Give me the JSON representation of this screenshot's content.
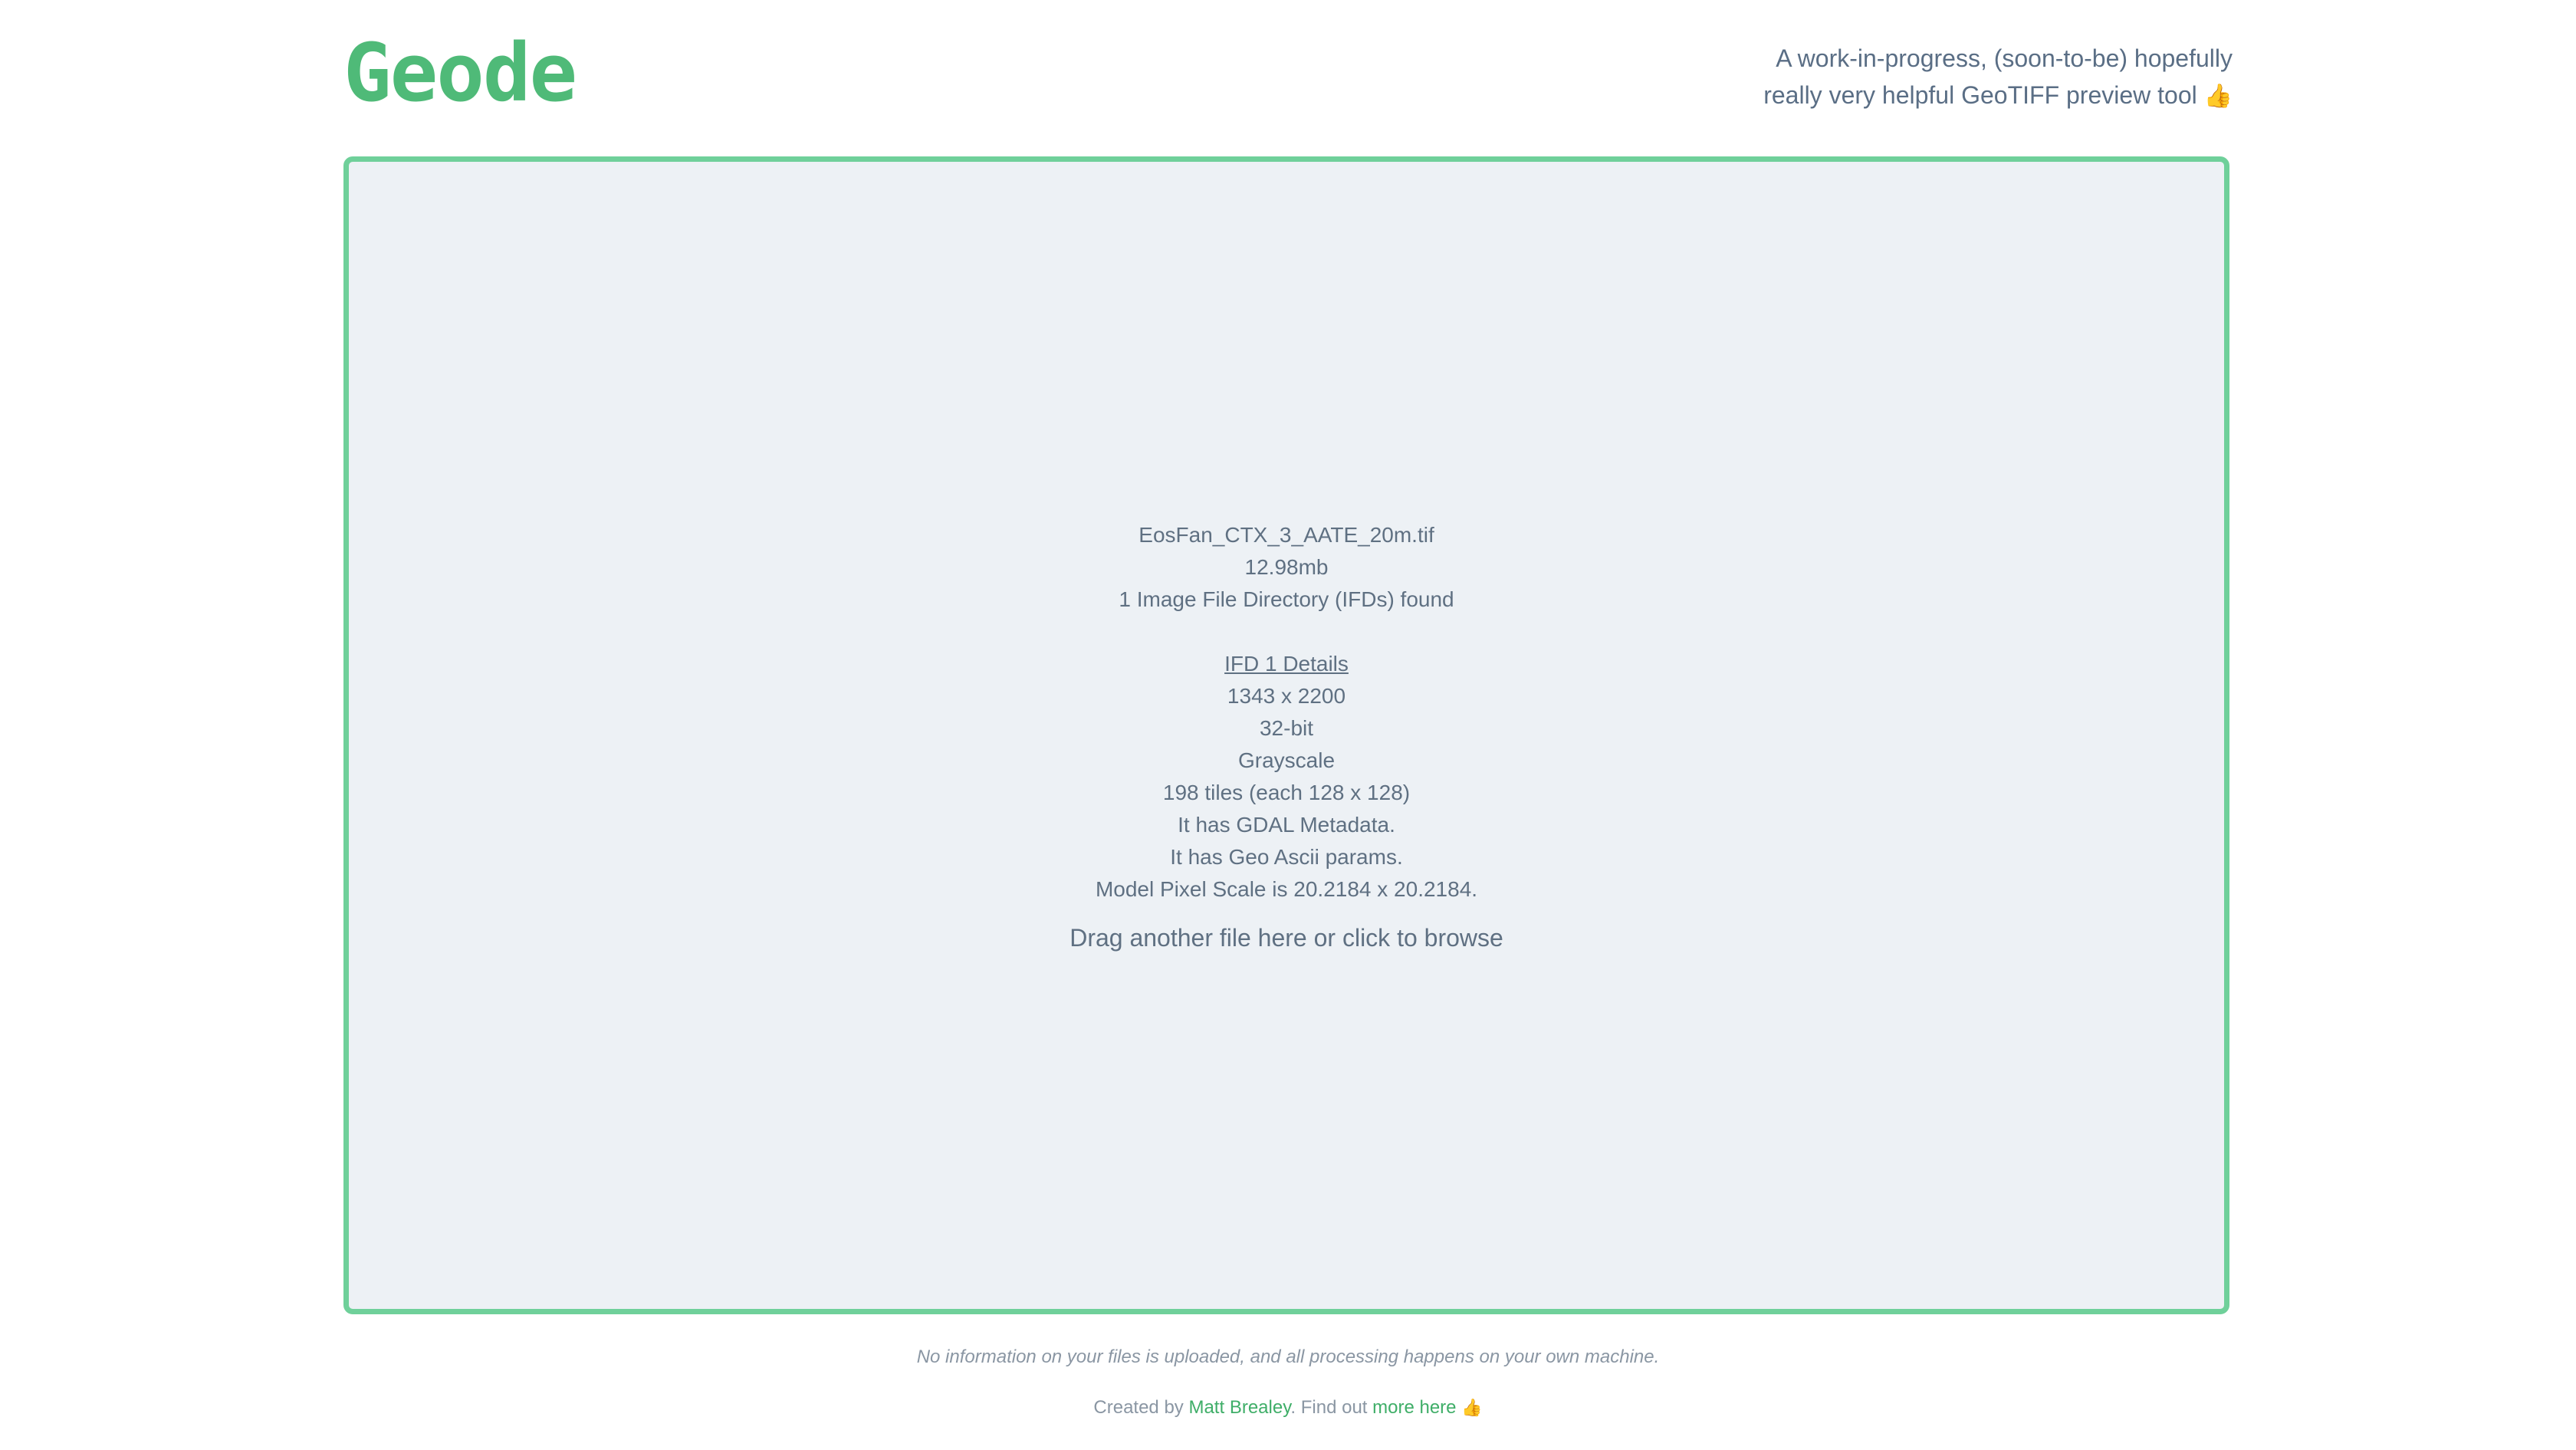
{
  "header": {
    "logo": "Geode",
    "tagline_line1": "A work-in-progress, (soon-to-be) hopefully",
    "tagline_line2": "really very helpful GeoTIFF preview tool",
    "tagline_icon": "thumbs-up-icon",
    "tagline_icon_glyph": "👍"
  },
  "dropzone": {
    "file_name": "EosFan_CTX_3_AATE_20m.tif",
    "file_size": "12.98mb",
    "ifd_count": "1 Image File Directory (IFDs) found",
    "ifd_title": "IFD 1 Details",
    "dimensions": "1343 x 2200",
    "bit_depth": "32-bit",
    "color_type": "Grayscale",
    "tiles": "198 tiles (each 128 x 128)",
    "gdal": "It has GDAL Metadata.",
    "geo_ascii": "It has Geo Ascii params.",
    "pixel_scale": "Model Pixel Scale is 20.2184 x 20.2184.",
    "prompt": "Drag another file here or click to browse"
  },
  "footer": {
    "note": "No information on your files is uploaded, and all processing happens on your own machine.",
    "created_by": "Created by",
    "author": "Matt Brealey",
    "find_out": ". Find out",
    "more_link": "more here",
    "icon": "thumbs-up-icon",
    "icon_glyph": "👍"
  },
  "colors": {
    "brand": "#4fba78",
    "dropzone_border": "#6fd09a",
    "dropzone_bg": "#edf1f5",
    "text": "#5f7082"
  }
}
